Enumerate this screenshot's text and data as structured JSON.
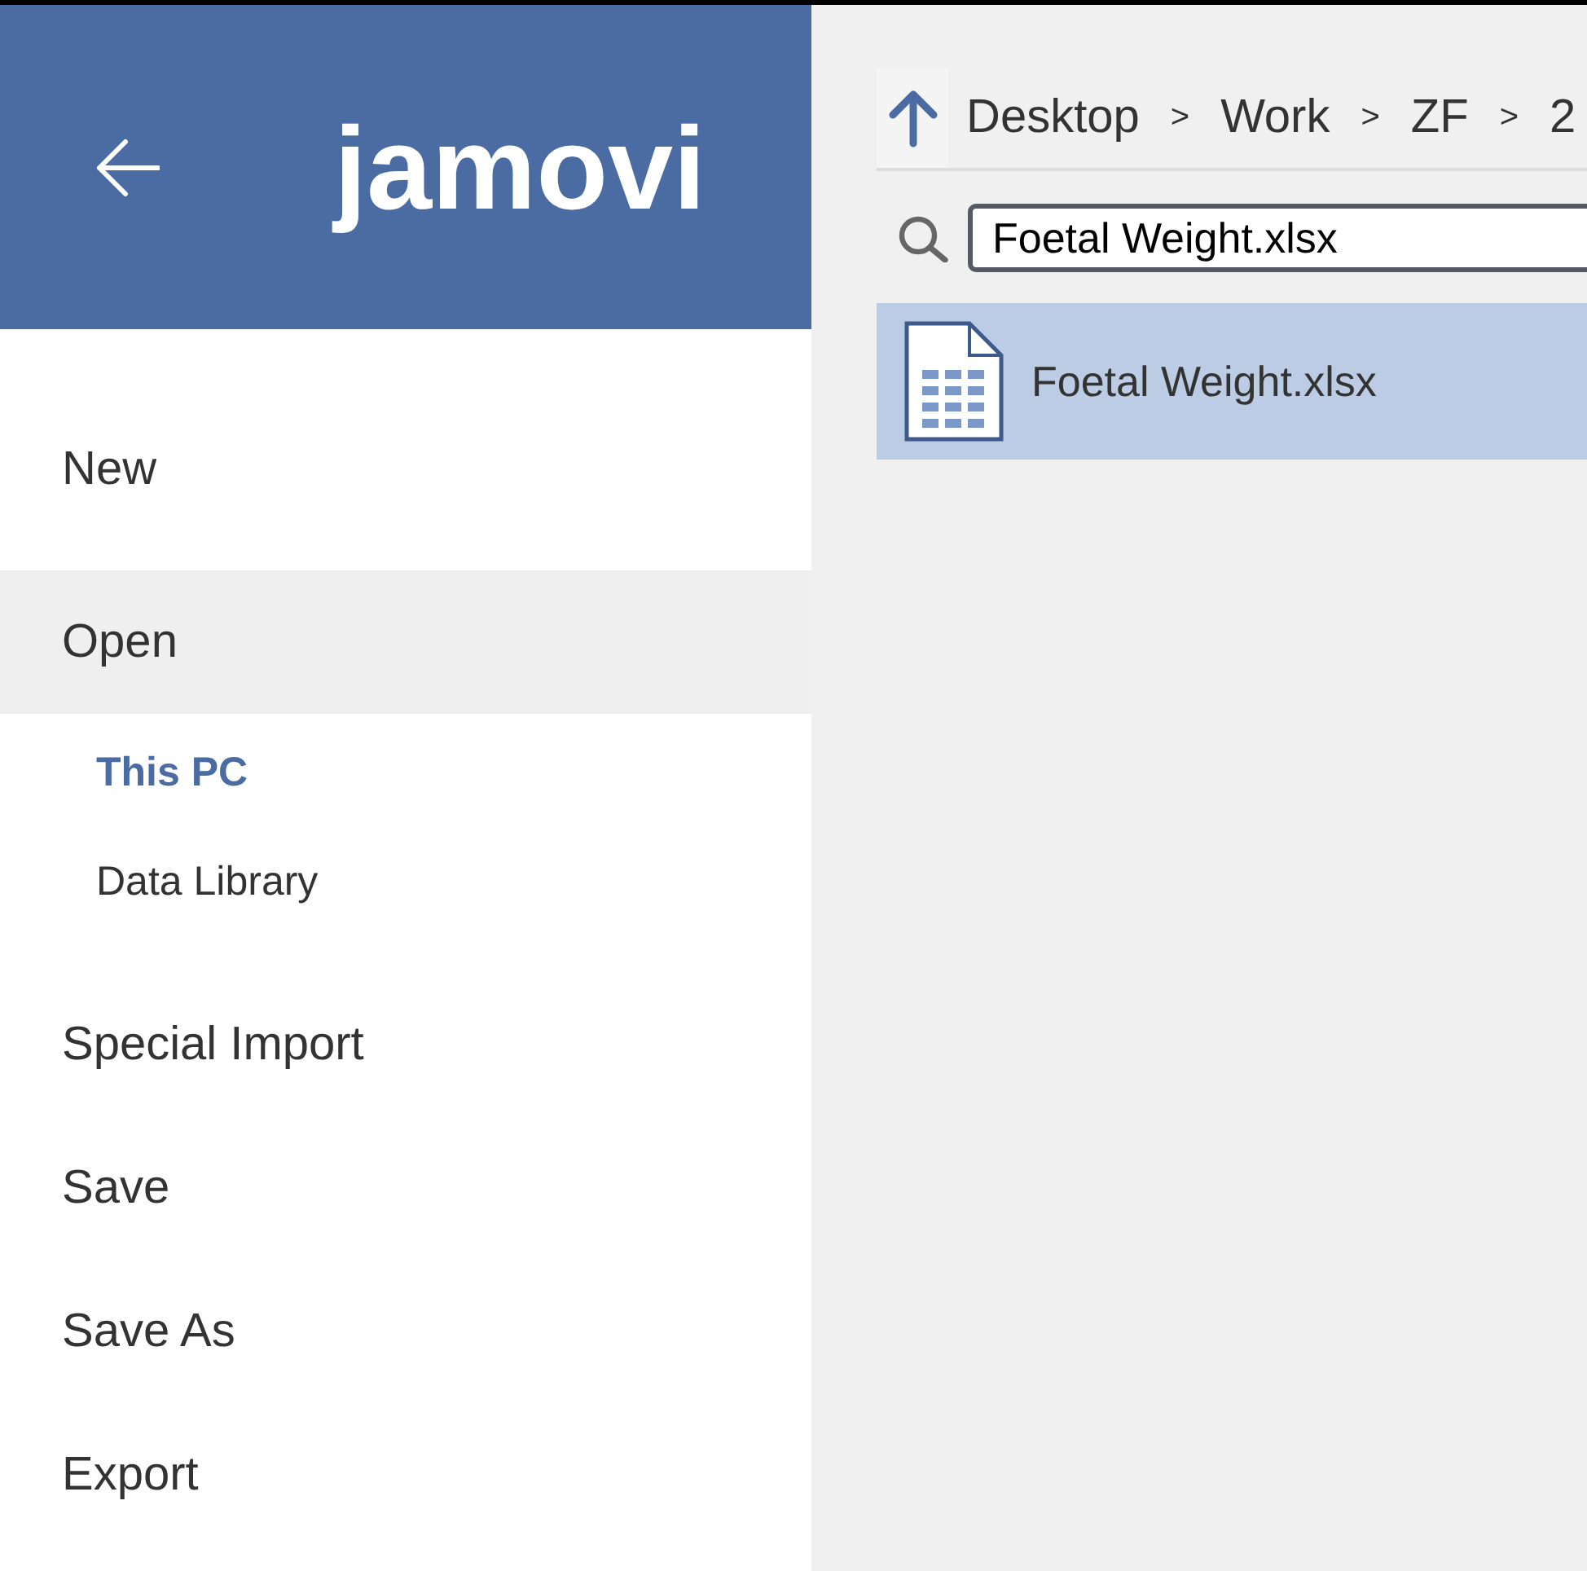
{
  "header": {
    "logo": "jamovi"
  },
  "menu": [
    {
      "label": "New",
      "selected": false
    },
    {
      "label": "Open",
      "selected": true,
      "children": [
        {
          "label": "This PC",
          "selected": true
        },
        {
          "label": "Data Library",
          "selected": false
        }
      ]
    },
    {
      "label": "Special Import",
      "selected": false
    },
    {
      "label": "Save",
      "selected": false
    },
    {
      "label": "Save As",
      "selected": false
    },
    {
      "label": "Export",
      "selected": false
    }
  ],
  "breadcrumb": [
    {
      "kind": "folder",
      "label": "Desktop"
    },
    {
      "kind": "separator",
      "label": ">"
    },
    {
      "kind": "folder",
      "label": "Work"
    },
    {
      "kind": "separator",
      "label": ">"
    },
    {
      "kind": "folder",
      "label": "ZF"
    },
    {
      "kind": "separator",
      "label": ">"
    },
    {
      "kind": "folder",
      "label": "2"
    }
  ],
  "search": {
    "value": "Foetal Weight.xlsx"
  },
  "files": [
    {
      "name": "Foetal Weight.xlsx",
      "selected": true
    }
  ]
}
